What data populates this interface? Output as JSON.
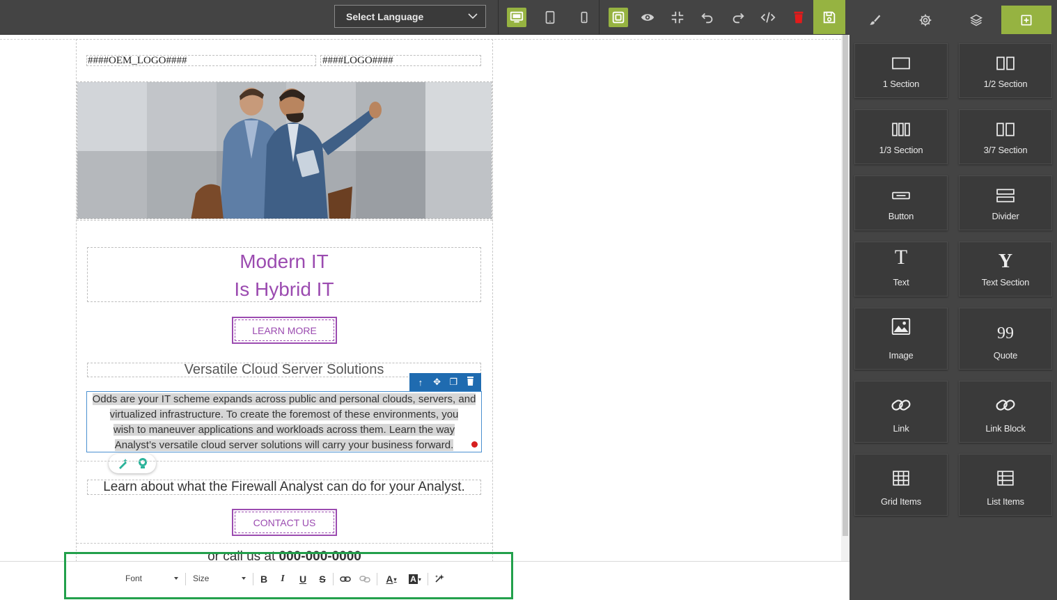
{
  "toolbar": {
    "language_select": {
      "value": "Select Language"
    },
    "buttons": [
      "desktop-view",
      "tablet-view",
      "mobile-view",
      "outline-toggle",
      "preview",
      "fullscreen",
      "undo",
      "redo",
      "code",
      "clear-canvas",
      "save"
    ]
  },
  "right_panel": {
    "tabs": [
      "style-manager",
      "settings",
      "layers",
      "blocks"
    ],
    "active_tab": "blocks",
    "blocks": [
      {
        "label": "1 Section",
        "icon": "one-section-icon"
      },
      {
        "label": "1/2 Section",
        "icon": "half-section-icon"
      },
      {
        "label": "1/3 Section",
        "icon": "third-section-icon"
      },
      {
        "label": "3/7 Section",
        "icon": "three-seven-section-icon"
      },
      {
        "label": "Button",
        "icon": "button-icon"
      },
      {
        "label": "Divider",
        "icon": "divider-icon"
      },
      {
        "label": "Text",
        "icon": "text-icon"
      },
      {
        "label": "Text Section",
        "icon": "text-section-icon"
      },
      {
        "label": "Image",
        "icon": "image-icon"
      },
      {
        "label": "Quote",
        "icon": "quote-icon"
      },
      {
        "label": "Link",
        "icon": "link-icon"
      },
      {
        "label": "Link Block",
        "icon": "link-block-icon"
      },
      {
        "label": "Grid Items",
        "icon": "grid-items-icon"
      },
      {
        "label": "List Items",
        "icon": "list-items-icon"
      }
    ]
  },
  "canvas": {
    "oem_logo": "####OEM_LOGO####",
    "logo": "####LOGO####",
    "headline_line1": "Modern IT",
    "headline_line2": "Is Hybrid IT",
    "learn_more_button": "LEARN MORE",
    "sub_heading": "Versatile Cloud Server Solutions",
    "paragraph_lines": [
      "Odds are your IT scheme expands across public and personal clouds, servers, and",
      "virtualized infrastructure. To create the foremost of these environments, you",
      "wish to maneuver applications and workloads across them. Learn the way",
      "Analyst’s versatile cloud server solutions will carry your business forward."
    ],
    "learn_line": "Learn about what the Firewall Analyst can do for your Analyst.",
    "contact_button": "CONTACT US",
    "call_prefix": "or call us at ",
    "call_number": "000-000-0000"
  },
  "element_toolbar": [
    "select-parent",
    "move",
    "copy",
    "delete"
  ],
  "text_toolbar": {
    "font_label": "Font",
    "size_label": "Size",
    "buttons": [
      "bold",
      "italic",
      "underline",
      "strikethrough",
      "link",
      "unlink",
      "font-color",
      "background-color",
      "ai-assist"
    ]
  },
  "colors": {
    "accent_green": "#96b341",
    "brand_purple": "#9b4bb0",
    "selection_blue": "#1f6bb0",
    "panel_dark": "#444444",
    "highlight_green": "#22a04b"
  }
}
